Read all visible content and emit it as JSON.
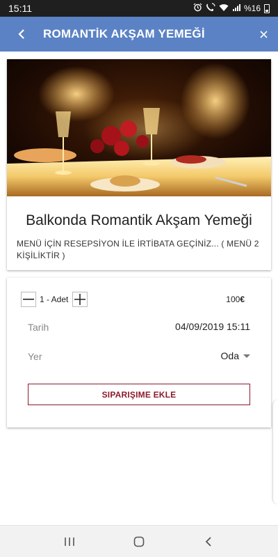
{
  "status_bar": {
    "time": "15:11",
    "battery": "%16",
    "icons": [
      "alarm-icon",
      "wifi-call-icon",
      "wifi-icon",
      "signal-icon",
      "battery-icon"
    ]
  },
  "app_bar": {
    "title": "ROMANTİK AKŞAM YEMEĞİ",
    "back_icon": "chevron-left-icon",
    "close_icon": "close-icon",
    "background": "#5b82c4"
  },
  "product": {
    "image": "romantic-dinner-photo",
    "title": "Balkonda Romantik Akşam Yemeği",
    "description": "MENÜ İÇİN RESEPSİYON İLE İRTİBATA GEÇİNİZ...  ( MENÜ 2 KİŞİLİKTİR )"
  },
  "order": {
    "quantity_label": "1 - Adet",
    "minus": "—",
    "plus": "+",
    "price": "100",
    "currency": "€",
    "date_label": "Tarih",
    "date_value": "04/09/2019 15:11",
    "place_label": "Yer",
    "place_value": "Oda",
    "submit_label": "SIPARIŞIME EKLE",
    "accent": "#8b1a2b"
  },
  "nav_bar": {
    "icons": [
      "recent-apps-icon",
      "home-icon",
      "back-icon"
    ]
  }
}
